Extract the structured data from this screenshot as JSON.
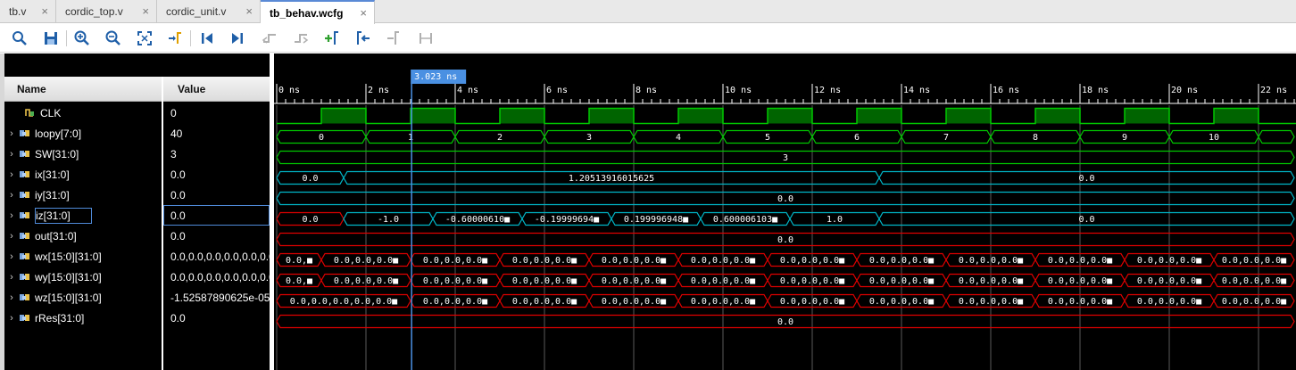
{
  "tabs": [
    {
      "label": "tb.v",
      "active": false
    },
    {
      "label": "cordic_top.v",
      "active": false
    },
    {
      "label": "cordic_unit.v",
      "active": false
    },
    {
      "label": "tb_behav.wcfg",
      "active": true
    }
  ],
  "tab_close_glyph": "×",
  "toolbar": {
    "icons": [
      "search-icon",
      "save-icon",
      "zoom-in-icon",
      "zoom-out-icon",
      "zoom-fit-icon",
      "goto-cursor-icon",
      "go-to-time-zero-icon",
      "go-to-last-time-icon",
      "previous-transition-icon",
      "next-transition-icon",
      "add-marker-icon",
      "previous-marker-icon",
      "next-marker-icon",
      "swap-cursors-icon"
    ]
  },
  "columns": {
    "name": "Name",
    "value": "Value"
  },
  "signals": [
    {
      "name": "CLK",
      "value": "0",
      "kind": "bit",
      "expandable": false
    },
    {
      "name": "loopy[7:0]",
      "value": "40",
      "kind": "bus",
      "expandable": true
    },
    {
      "name": "SW[31:0]",
      "value": "3",
      "kind": "bus",
      "expandable": true
    },
    {
      "name": "ix[31:0]",
      "value": "0.0",
      "kind": "bus",
      "expandable": true
    },
    {
      "name": "iy[31:0]",
      "value": "0.0",
      "kind": "bus",
      "expandable": true
    },
    {
      "name": "iz[31:0]",
      "value": "0.0",
      "kind": "bus",
      "expandable": true,
      "selected": true
    },
    {
      "name": "out[31:0]",
      "value": "0.0",
      "kind": "bus",
      "expandable": true
    },
    {
      "name": "wx[15:0][31:0]",
      "value": "0.0,0.0,0.0,0.0,0.0,0.0,0.",
      "kind": "bus",
      "expandable": true
    },
    {
      "name": "wy[15:0][31:0]",
      "value": "0.0,0.0,0.0,0.0,0.0,0.0,0.",
      "kind": "bus",
      "expandable": true
    },
    {
      "name": "wz[15:0][31:0]",
      "value": "-1.52587890625e-05",
      "kind": "bus",
      "expandable": true
    },
    {
      "name": "rRes[31:0]",
      "value": "0.0",
      "kind": "bus",
      "expandable": true
    }
  ],
  "timeline": {
    "unit": "ns",
    "major_ticks": [
      0,
      2,
      4,
      6,
      8,
      10,
      12,
      14,
      16,
      18,
      20,
      22
    ],
    "tick_label_suffix": " ns",
    "visible_end": 22.8,
    "cursor_time": 3.023,
    "cursor_label": "3.023 ns"
  },
  "waves": {
    "clk": {
      "high_intervals": [
        [
          1,
          2
        ],
        [
          3,
          4
        ],
        [
          5,
          6
        ],
        [
          7,
          8
        ],
        [
          9,
          10
        ],
        [
          11,
          12
        ],
        [
          13,
          14
        ],
        [
          15,
          16
        ],
        [
          17,
          18
        ],
        [
          19,
          20
        ],
        [
          21,
          22
        ]
      ]
    },
    "loopy": {
      "segments": [
        [
          0,
          2,
          "0"
        ],
        [
          2,
          4,
          "1"
        ],
        [
          4,
          6,
          "2"
        ],
        [
          6,
          8,
          "3"
        ],
        [
          8,
          10,
          "4"
        ],
        [
          10,
          12,
          "5"
        ],
        [
          12,
          14,
          "6"
        ],
        [
          14,
          16,
          "7"
        ],
        [
          16,
          18,
          "8"
        ],
        [
          18,
          20,
          "9"
        ],
        [
          20,
          22,
          "10"
        ],
        [
          22,
          22.8,
          ""
        ]
      ],
      "color": "#00c800"
    },
    "sw": {
      "segments": [
        [
          0,
          22.8,
          "3"
        ]
      ],
      "color": "#00c800"
    },
    "ix": {
      "segments": [
        [
          0,
          1.5,
          "0.0"
        ],
        [
          1.5,
          13.5,
          "1.20513916015625"
        ],
        [
          13.5,
          22.8,
          "0.0"
        ]
      ],
      "color": "#00b7c8"
    },
    "iy": {
      "segments": [
        [
          0,
          22.8,
          "0.0"
        ]
      ],
      "color": "#00b7c8"
    },
    "iz": {
      "segments": [
        [
          0,
          1.5,
          "0.0"
        ],
        [
          1.5,
          3.5,
          "-1.0"
        ],
        [
          3.5,
          5.5,
          "-0.60000610■"
        ],
        [
          5.5,
          7.5,
          "-0.19999694■"
        ],
        [
          7.5,
          9.5,
          "0.199996948■"
        ],
        [
          9.5,
          11.5,
          "0.600006103■"
        ],
        [
          11.5,
          13.5,
          "1.0"
        ],
        [
          13.5,
          22.8,
          "0.0"
        ]
      ],
      "color": "#00b7c8",
      "first_segment_color": "#e00000"
    },
    "out": {
      "segments": [
        [
          0,
          22.8,
          "0.0"
        ]
      ],
      "color": "#e00000"
    },
    "wx": {
      "segments": [
        [
          0,
          1,
          "0.0,■"
        ],
        [
          1,
          3,
          "0.0,0.0,0.0■"
        ],
        [
          3,
          5,
          "0.0,0.0,0.0■"
        ],
        [
          5,
          7,
          "0.0,0.0,0.0■"
        ],
        [
          7,
          9,
          "0.0,0.0,0.0■"
        ],
        [
          9,
          11,
          "0.0,0.0,0.0■"
        ],
        [
          11,
          13,
          "0.0,0.0,0.0■"
        ],
        [
          13,
          15,
          "0.0,0.0,0.0■"
        ],
        [
          15,
          17,
          "0.0,0.0,0.0■"
        ],
        [
          17,
          19,
          "0.0,0.0,0.0■"
        ],
        [
          19,
          21,
          "0.0,0.0,0.0■"
        ],
        [
          21,
          22.8,
          "0.0,0.0,0.0■"
        ]
      ],
      "color": "#e00000"
    },
    "wy": {
      "segments": [
        [
          0,
          1,
          "0.0,■"
        ],
        [
          1,
          3,
          "0.0,0.0,0.0■"
        ],
        [
          3,
          5,
          "0.0,0.0,0.0■"
        ],
        [
          5,
          7,
          "0.0,0.0,0.0■"
        ],
        [
          7,
          9,
          "0.0,0.0,0.0■"
        ],
        [
          9,
          11,
          "0.0,0.0,0.0■"
        ],
        [
          11,
          13,
          "0.0,0.0,0.0■"
        ],
        [
          13,
          15,
          "0.0,0.0,0.0■"
        ],
        [
          15,
          17,
          "0.0,0.0,0.0■"
        ],
        [
          17,
          19,
          "0.0,0.0,0.0■"
        ],
        [
          19,
          21,
          "0.0,0.0,0.0■"
        ],
        [
          21,
          22.8,
          "0.0,0.0,0.0■"
        ]
      ],
      "color": "#e00000"
    },
    "wz": {
      "segments": [
        [
          0,
          3,
          "0.0,0.0,0.0,0.0,0.0■"
        ],
        [
          3,
          5,
          "0.0,0.0,0.0■"
        ],
        [
          5,
          7,
          "0.0,0.0,0.0■"
        ],
        [
          7,
          9,
          "0.0,0.0,0.0■"
        ],
        [
          9,
          11,
          "0.0,0.0,0.0■"
        ],
        [
          11,
          13,
          "0.0,0.0,0.0■"
        ],
        [
          13,
          15,
          "0.0,0.0,0.0■"
        ],
        [
          15,
          17,
          "0.0,0.0,0.0■"
        ],
        [
          17,
          19,
          "0.0,0.0,0.0■"
        ],
        [
          19,
          21,
          "0.0,0.0,0.0■"
        ],
        [
          21,
          22.8,
          "0.0,0.0,0.0■"
        ]
      ],
      "color": "#e00000"
    },
    "rres": {
      "segments": [
        [
          0,
          22.8,
          "0.0"
        ]
      ],
      "color": "#e00000"
    }
  },
  "colors": {
    "background": "#000000",
    "clk": "#00c800",
    "clk_fill": "#006400",
    "cursor": "#4a90e2",
    "grid": "#5a5a5a",
    "ruler_text": "#ffffff"
  }
}
